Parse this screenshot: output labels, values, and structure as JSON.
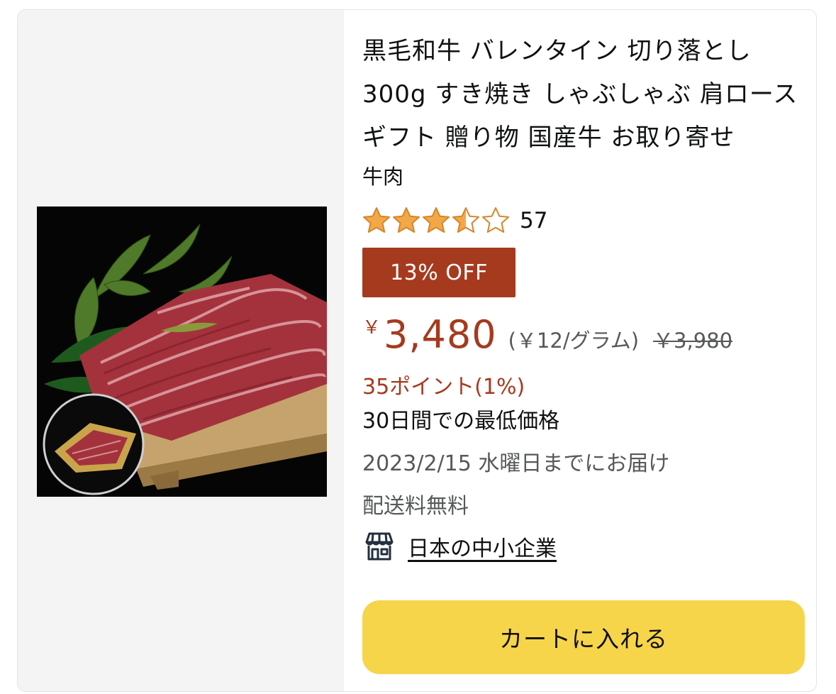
{
  "product": {
    "title": "黒毛和牛 バレンタイン 切り落とし 300g すき焼き しゃぶしゃぶ 肩ロース ギフト 贈り物 国産牛 お取り寄せ",
    "category": "牛肉",
    "image_icon": "beef-slices-on-wooden-tray-photo",
    "rating": 3.5,
    "rating_max": 5,
    "review_count": "57",
    "deal_badge": "13% OFF",
    "currency_symbol": "￥",
    "price": "3,480",
    "unit_price": "(￥12/グラム)",
    "list_price": "￥3,980",
    "points": "35ポイント(1%)",
    "lowest_price_note": "30日間での最低価格",
    "delivery": "2023/2/15 水曜日までにお届け",
    "shipping": "配送料無料",
    "seller_badge": "日本の中小企業",
    "seller_icon": "storefront-icon",
    "cart_button": "カートに入れる"
  },
  "colors": {
    "deal_red": "#a63a1e",
    "star_orange": "#f3a847",
    "cart_yellow": "#f7d54a",
    "text_primary": "#0f1111",
    "text_secondary": "#565959",
    "image_pane_bg": "#f4f4f4"
  }
}
